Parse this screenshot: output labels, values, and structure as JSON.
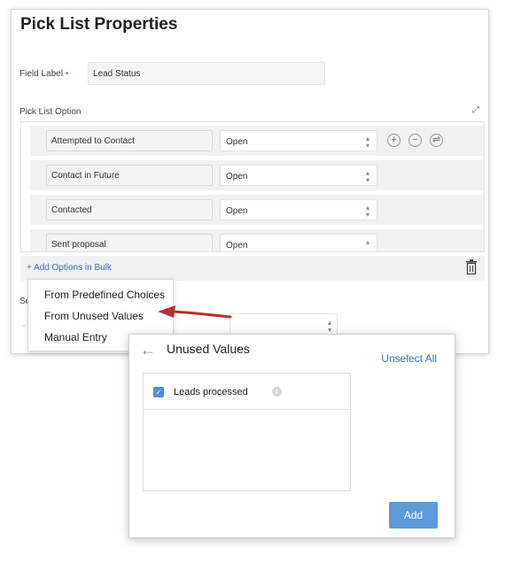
{
  "panel": {
    "title": "Pick List Properties",
    "field_label": "Field Label",
    "required_mark": "•",
    "field_value": "Lead Status",
    "section_label": "Pick List Option",
    "expand_icon": "expand-icon"
  },
  "options": [
    {
      "name": "Attempted to Contact",
      "status": "Open"
    },
    {
      "name": "Contact in Future",
      "status": "Open"
    },
    {
      "name": "Contacted",
      "status": "Open"
    },
    {
      "name": "Sent proposal",
      "status": "Open"
    }
  ],
  "row_controls": {
    "add": "+",
    "remove": "−",
    "reorder": "⇌"
  },
  "bulk": {
    "label": "+ Add Options in Bulk",
    "trash_icon": "trash-icon"
  },
  "background": {
    "se_label": "Se",
    "se_dash": "-"
  },
  "menu": {
    "items": [
      "From Predefined Choices",
      "From Unused Values",
      "Manual Entry"
    ]
  },
  "popup": {
    "title": "Unused Values",
    "unselect_all": "Unselect All",
    "values": [
      {
        "label": "Leads processed",
        "checked": true
      }
    ],
    "add_label": "Add"
  },
  "colors": {
    "accent": "#3a75c4",
    "button": "#5b9bd9",
    "arrow": "#b8312f"
  }
}
